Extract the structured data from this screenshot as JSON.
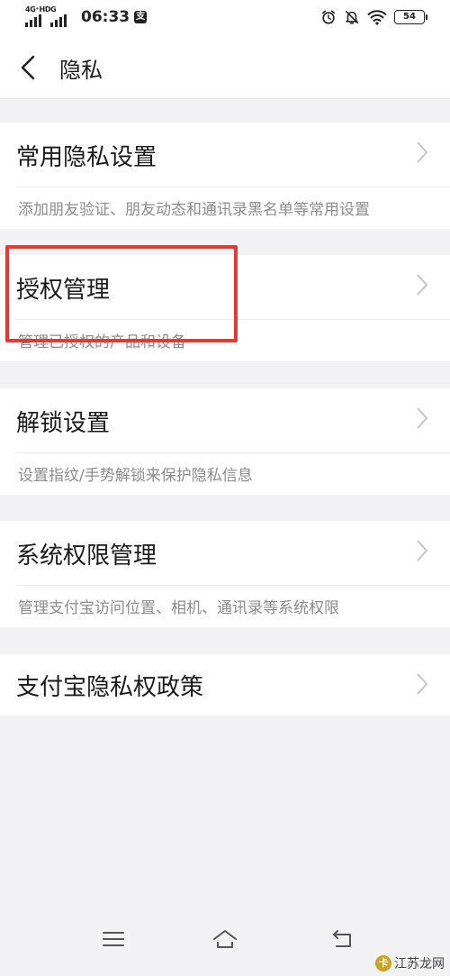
{
  "status_bar": {
    "network_1": "4G⁺HD",
    "network_2": "G",
    "time": "06:33",
    "app_badge": "支",
    "battery": "54"
  },
  "header": {
    "title": "隐私"
  },
  "rows": [
    {
      "title": "常用隐私设置",
      "description": "添加朋友验证、朋友动态和通讯录黑名单等常用设置"
    },
    {
      "title": "授权管理",
      "description": "管理已授权的产品和设备"
    },
    {
      "title": "解锁设置",
      "description": "设置指纹/手势解锁来保护隐私信息"
    },
    {
      "title": "系统权限管理",
      "description": "管理支付宝访问位置、相机、通讯录等系统权限"
    },
    {
      "title": "支付宝隐私权政策"
    }
  ],
  "highlight_color": "#e53935",
  "watermark": {
    "logo_char": "卡",
    "text": "江苏龙网"
  }
}
